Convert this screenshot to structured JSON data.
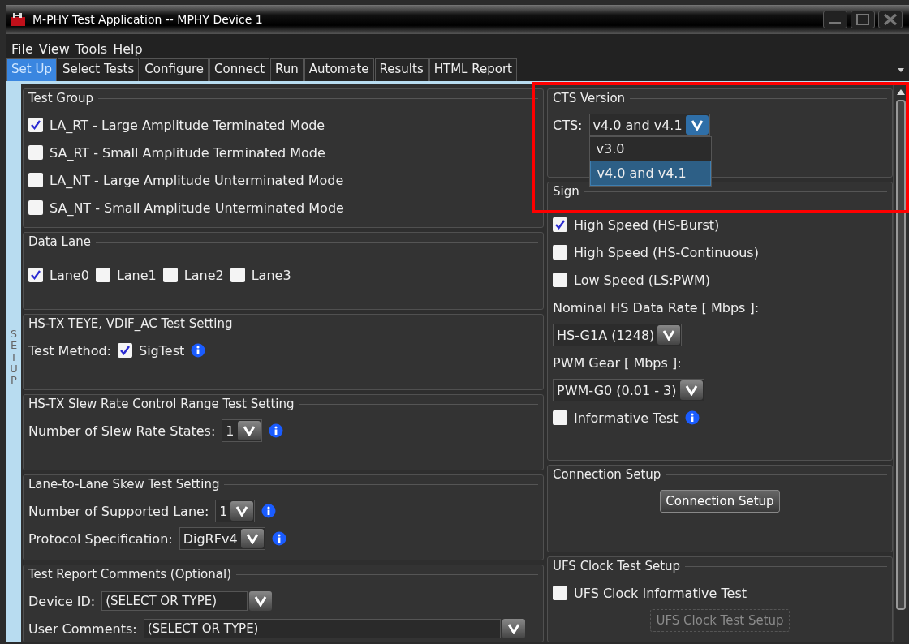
{
  "window": {
    "title": "M-PHY Test Application -- MPHY Device 1"
  },
  "menu": [
    "File",
    "View",
    "Tools",
    "Help"
  ],
  "tabs": [
    {
      "label": "Set Up",
      "selected": true
    },
    {
      "label": "Select Tests",
      "selected": false
    },
    {
      "label": "Configure",
      "selected": false
    },
    {
      "label": "Connect",
      "selected": false
    },
    {
      "label": "Run",
      "selected": false
    },
    {
      "label": "Automate",
      "selected": false
    },
    {
      "label": "Results",
      "selected": false
    },
    {
      "label": "HTML Report",
      "selected": false
    }
  ],
  "side_label": "SET UP",
  "left_groups": [
    {
      "title": "Test Group",
      "rows": [
        [
          {
            "kind": "checkbox",
            "label": "LA_RT - Large Amplitude Terminated Mode",
            "checked": true
          }
        ],
        [
          {
            "kind": "checkbox",
            "label": "SA_RT - Small Amplitude Terminated Mode",
            "checked": false
          }
        ],
        [
          {
            "kind": "checkbox",
            "label": "LA_NT - Large Amplitude Unterminated Mode",
            "checked": false
          }
        ],
        [
          {
            "kind": "checkbox",
            "label": "SA_NT - Small Amplitude Unterminated Mode",
            "checked": false
          }
        ]
      ]
    },
    {
      "title": "Data Lane",
      "rows": [
        [
          {
            "kind": "checkbox",
            "label": "Lane0",
            "checked": true
          },
          {
            "kind": "checkbox",
            "label": "Lane1",
            "checked": false
          },
          {
            "kind": "checkbox",
            "label": "Lane2",
            "checked": false
          },
          {
            "kind": "checkbox",
            "label": "Lane3",
            "checked": false
          }
        ]
      ]
    },
    {
      "title": "HS-TX TEYE, VDIF_AC Test Setting",
      "rows": [
        [
          {
            "kind": "label",
            "text": "Test Method:"
          },
          {
            "kind": "checkbox",
            "label": "SigTest",
            "checked": true
          },
          {
            "kind": "info"
          }
        ]
      ]
    },
    {
      "title": "HS-TX Slew Rate Control Range Test Setting",
      "rows": [
        [
          {
            "kind": "label",
            "text": "Number of Slew Rate States:"
          },
          {
            "kind": "select",
            "value": "1"
          },
          {
            "kind": "info"
          }
        ]
      ]
    },
    {
      "title": "Lane-to-Lane Skew Test Setting",
      "rows": [
        [
          {
            "kind": "label",
            "text": "Number of Supported Lane:"
          },
          {
            "kind": "select",
            "value": "1"
          },
          {
            "kind": "info"
          }
        ],
        [
          {
            "kind": "label",
            "text": "Protocol Specification:"
          },
          {
            "kind": "select",
            "value": "DigRFv4"
          },
          {
            "kind": "info"
          }
        ]
      ]
    },
    {
      "title": "Test Report Comments (Optional)",
      "rows": [
        [
          {
            "kind": "label",
            "text": "Device ID:"
          },
          {
            "kind": "combo",
            "placeholder": "(SELECT OR TYPE)"
          }
        ],
        [
          {
            "kind": "label",
            "text": "User Comments:"
          },
          {
            "kind": "combo",
            "placeholder": "(SELECT OR TYPE)",
            "wide": true
          }
        ]
      ]
    }
  ],
  "right_groups": [
    {
      "title": "CTS Version",
      "rows": [
        [
          {
            "kind": "label",
            "text": "CTS:"
          },
          {
            "kind": "select",
            "value": "v4.0 and v4.1",
            "open": true,
            "options": [
              {
                "label": "v3.0",
                "selected": false
              },
              {
                "label": "v4.0 and v4.1",
                "selected": true
              }
            ]
          }
        ]
      ]
    },
    {
      "title": "Sign",
      "rows": [
        [
          {
            "kind": "checkbox",
            "label": "High Speed (HS-Burst)",
            "checked": true
          }
        ],
        [
          {
            "kind": "checkbox",
            "label": "High Speed (HS-Continuous)",
            "checked": false
          }
        ],
        [
          {
            "kind": "checkbox",
            "label": "Low Speed (LS:PWM)",
            "checked": false
          }
        ],
        [
          {
            "kind": "label",
            "text": "Nominal HS Data Rate [ Mbps ]:"
          }
        ],
        [
          {
            "kind": "select",
            "value": "HS-G1A (1248)"
          }
        ],
        [
          {
            "kind": "label",
            "text": "PWM Gear [ Mbps ]:"
          }
        ],
        [
          {
            "kind": "select",
            "value": "PWM-G0 (0.01 - 3)"
          }
        ],
        [
          {
            "kind": "checkbox",
            "label": "Informative Test",
            "checked": false
          },
          {
            "kind": "info"
          }
        ]
      ]
    },
    {
      "title": "Connection Setup",
      "rows": [
        [
          {
            "kind": "button",
            "label": "Connection Setup",
            "disabled": false
          }
        ]
      ]
    },
    {
      "title": "UFS Clock Test Setup",
      "rows": [
        [
          {
            "kind": "checkbox",
            "label": "UFS Clock Informative Test",
            "checked": false
          }
        ],
        [
          {
            "kind": "button",
            "label": "UFS Clock Test Setup",
            "disabled": true
          }
        ]
      ]
    }
  ]
}
